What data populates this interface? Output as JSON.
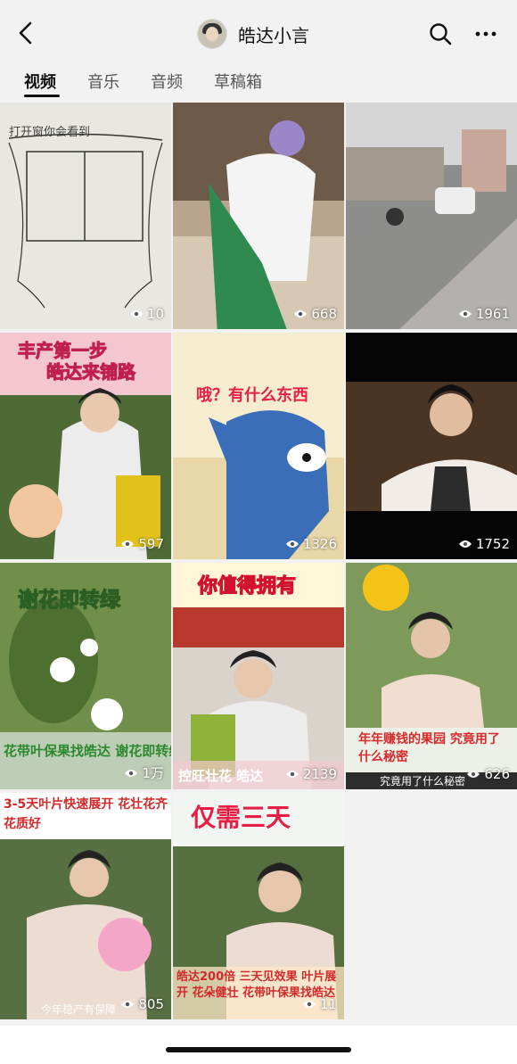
{
  "header": {
    "title": "皓达小言",
    "back_icon": "chevron-left-icon",
    "search_icon": "search-icon",
    "more_icon": "more-icon"
  },
  "tabs": [
    {
      "label": "视频",
      "active": true
    },
    {
      "label": "音乐",
      "active": false
    },
    {
      "label": "音频",
      "active": false
    },
    {
      "label": "草稿箱",
      "active": false
    }
  ],
  "videos": [
    {
      "views": "10",
      "caption": "打开窗你会看到"
    },
    {
      "views": "668",
      "caption": ""
    },
    {
      "views": "1961",
      "caption": ""
    },
    {
      "views": "597",
      "caption": "丰产第一步 皓达来铺路"
    },
    {
      "views": "1326",
      "caption": "哦？有什么东西"
    },
    {
      "views": "1752",
      "caption": ""
    },
    {
      "views": "1万",
      "caption": "谢花即转绿",
      "caption2": "花带叶保果找皓达 谢花即转绿"
    },
    {
      "views": "2139",
      "caption": "你值得拥有",
      "caption2": "控旺壮花 皓达"
    },
    {
      "views": "626",
      "caption": "年年赚钱的果园 究竟用了什么秘密",
      "caption2": "究竟用了什么秘密"
    },
    {
      "views": "805",
      "caption": "3-5天叶片快速展开 花壮花齐花质好",
      "caption2": "今年稳产有保障"
    },
    {
      "views": "11",
      "caption": "仅需三天",
      "caption2": "皓达200倍 三天见效果 叶片展开 花朵健壮 花带叶保果找皓达"
    }
  ]
}
